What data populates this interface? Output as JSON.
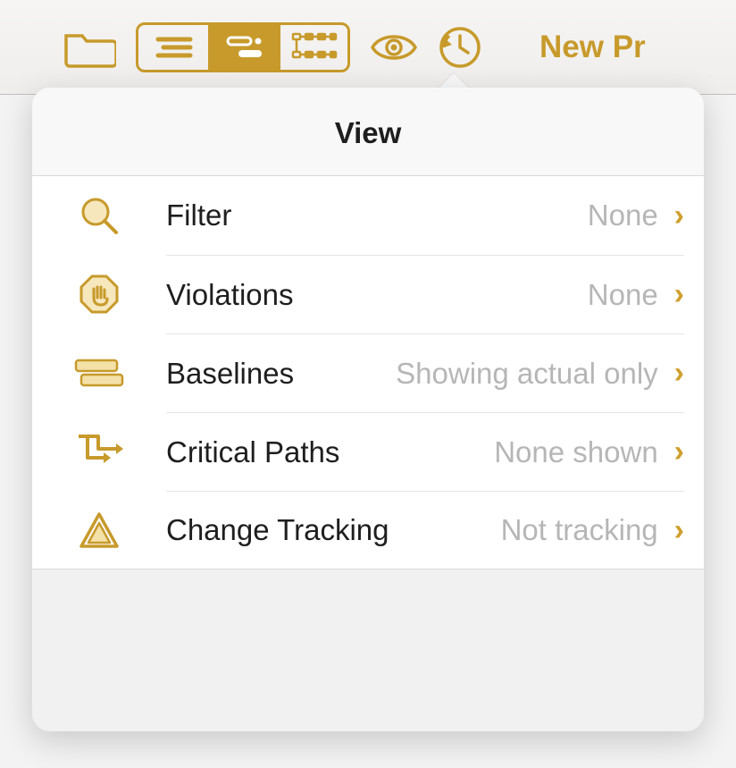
{
  "toolbar": {
    "title_right": "New Pr"
  },
  "popover": {
    "title": "View",
    "rows": [
      {
        "label": "Filter",
        "value": "None"
      },
      {
        "label": "Violations",
        "value": "None"
      },
      {
        "label": "Baselines",
        "value": "Showing actual only"
      },
      {
        "label": "Critical Paths",
        "value": "None shown"
      },
      {
        "label": "Change Tracking",
        "value": "Not tracking"
      }
    ]
  }
}
